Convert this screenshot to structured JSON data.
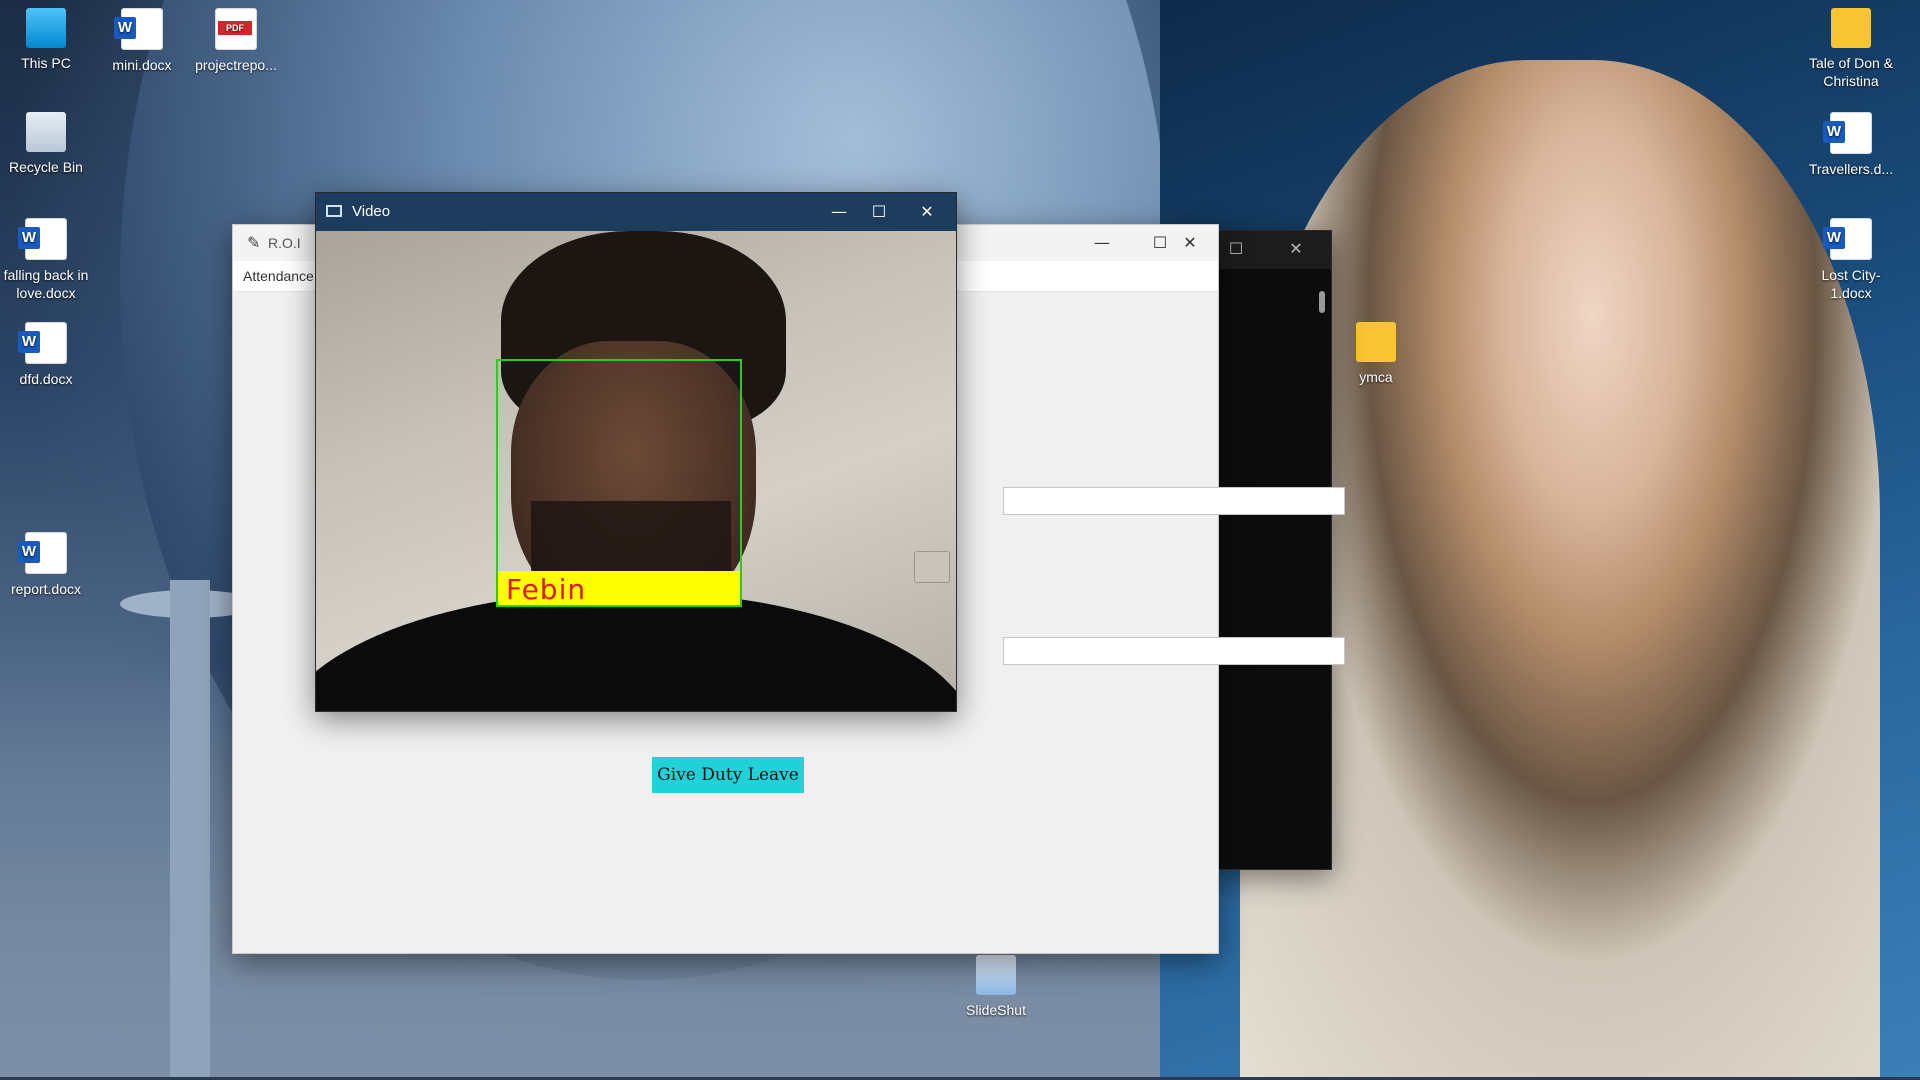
{
  "desktop": {
    "icons": [
      {
        "label": "This PC"
      },
      {
        "label": "mini.docx"
      },
      {
        "label": "projectrepo..."
      },
      {
        "label": "Recycle Bin"
      },
      {
        "label": "falling back in love.docx"
      },
      {
        "label": "dfd.docx"
      },
      {
        "label": "report.docx"
      },
      {
        "label": "Tale of Don & Christina"
      },
      {
        "label": "Travellers.d..."
      },
      {
        "label": "Lost City-1.docx"
      },
      {
        "label": "ymca"
      },
      {
        "label": "SlideShut"
      }
    ]
  },
  "roi_window": {
    "title": "R.O.I",
    "menu_text": "Attendance",
    "button_label": "Give Duty Leave",
    "button_color": "#20d1d8"
  },
  "video_window": {
    "title": "Video",
    "detected_name": "Febin",
    "box_color": "#1ed21e",
    "label_bg": "#ffff00",
    "label_color": "#e01818"
  },
  "window_controls": {
    "minimize": "—",
    "maximize": "☐",
    "close": "✕"
  }
}
